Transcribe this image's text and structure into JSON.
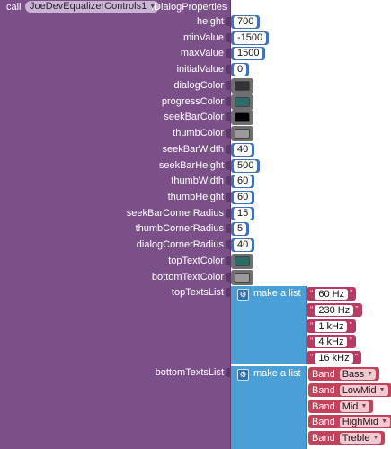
{
  "call": {
    "keyword": "call",
    "component": "JoeDevEqualizerControls1",
    "method": ".DialogProperties"
  },
  "params": [
    {
      "name": "height",
      "kind": "number",
      "value": "700"
    },
    {
      "name": "minValue",
      "kind": "number",
      "value": "-1500"
    },
    {
      "name": "maxValue",
      "kind": "number",
      "value": "1500"
    },
    {
      "name": "initialValue",
      "kind": "number",
      "value": "0"
    },
    {
      "name": "dialogColor",
      "kind": "color",
      "value": "#333333"
    },
    {
      "name": "progressColor",
      "kind": "color",
      "value": "#2e6b66"
    },
    {
      "name": "seekBarColor",
      "kind": "color",
      "value": "#000000"
    },
    {
      "name": "thumbColor",
      "kind": "color",
      "value": "#9a9a9a"
    },
    {
      "name": "seekBarWidth",
      "kind": "number",
      "value": "40"
    },
    {
      "name": "seekBarHeight",
      "kind": "number",
      "value": "500"
    },
    {
      "name": "thumbWidth",
      "kind": "number",
      "value": "60"
    },
    {
      "name": "thumbHeight",
      "kind": "number",
      "value": "60"
    },
    {
      "name": "seekBarCornerRadius",
      "kind": "number",
      "value": "15"
    },
    {
      "name": "thumbCornerRadius",
      "kind": "number",
      "value": "5"
    },
    {
      "name": "dialogCornerRadius",
      "kind": "number",
      "value": "40"
    },
    {
      "name": "topTextColor",
      "kind": "color",
      "value": "#2e6b66"
    },
    {
      "name": "bottomTextColor",
      "kind": "color",
      "value": "#9a9a9a"
    },
    {
      "name": "topTextsList",
      "kind": "list"
    },
    {
      "name": "bottomTextsList",
      "kind": "list"
    }
  ],
  "topTextsList": {
    "label": "make a list",
    "items": [
      "60 Hz",
      "230 Hz",
      "1 kHz",
      "4 kHz",
      "16 kHz"
    ]
  },
  "bottomTextsList": {
    "label": "make a list",
    "items": [
      {
        "prefix": "Band",
        "option": "Bass"
      },
      {
        "prefix": "Band",
        "option": "LowMid"
      },
      {
        "prefix": "Band",
        "option": "Mid"
      },
      {
        "prefix": "Band",
        "option": "HighMid"
      },
      {
        "prefix": "Band",
        "option": "Treble"
      }
    ]
  },
  "colors": {
    "call_block": "#7b4f88",
    "number_block": "#3f72b9",
    "list_block": "#4a9fd6",
    "text_block": "#b63a62",
    "join_block": "#c2425a"
  }
}
